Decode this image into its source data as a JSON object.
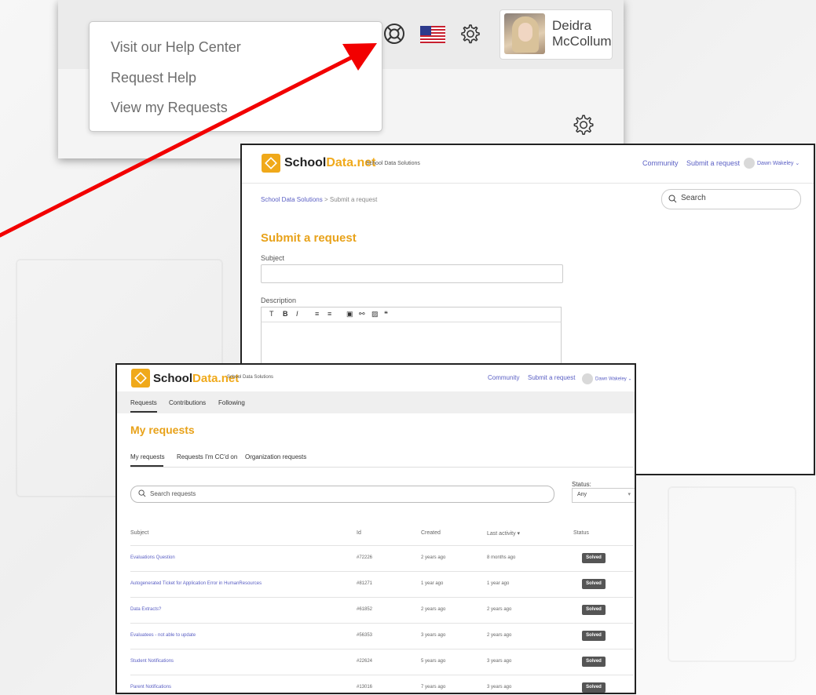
{
  "colors": {
    "accent": "#f0a91a",
    "link": "#5a5fc4",
    "arrow": "#f20000",
    "badge": "#555555"
  },
  "help_header": {
    "menu": {
      "items": [
        "Visit our Help Center",
        "Request Help",
        "View my Requests"
      ]
    },
    "icons": [
      "help-lifebuoy-icon",
      "us-flag-icon",
      "gear-icon"
    ],
    "user": {
      "first_name": "Deidra",
      "last_name": "McCollum"
    }
  },
  "submit_page": {
    "brand": {
      "school": "School",
      "data": "Data.net",
      "sub": "School Data Solutions"
    },
    "nav": {
      "community": "Community",
      "submit": "Submit a request",
      "user": "Dawn Wakeley ⌄"
    },
    "breadcrumb": {
      "root": "School Data Solutions",
      "sep": ">",
      "current": "Submit a request"
    },
    "search_placeholder": "Search",
    "title": "Submit a request",
    "subject_label": "Subject",
    "description_label": "Description",
    "toolbar": [
      "T",
      "B",
      "I",
      "≡",
      "≡",
      "▣",
      "⚯",
      "▨",
      "❝"
    ]
  },
  "requests_page": {
    "brand": {
      "school": "School",
      "data": "Data.net",
      "sub": "School Data Solutions"
    },
    "nav": {
      "community": "Community",
      "submit": "Submit a request",
      "user": "Dawn Wakeley ⌄"
    },
    "subnav": [
      "Requests",
      "Contributions",
      "Following"
    ],
    "title": "My requests",
    "tabs": [
      "My requests",
      "Requests I'm CC'd on",
      "Organization requests"
    ],
    "search_placeholder": "Search requests",
    "status_label": "Status:",
    "status_value": "Any",
    "columns": [
      "Subject",
      "Id",
      "Created",
      "Last activity ▾",
      "Status"
    ],
    "rows": [
      {
        "subject": "Evaluations Question",
        "id": "#72226",
        "created": "2 years ago",
        "last": "8 months ago",
        "status": "Solved"
      },
      {
        "subject": "Autogenerated Ticket for Application Error in HumanResources",
        "id": "#81271",
        "created": "1 year ago",
        "last": "1 year ago",
        "status": "Solved"
      },
      {
        "subject": "Data Extracts?",
        "id": "#61852",
        "created": "2 years ago",
        "last": "2 years ago",
        "status": "Solved"
      },
      {
        "subject": "Evaluatees - not able to update",
        "id": "#56353",
        "created": "3 years ago",
        "last": "2 years ago",
        "status": "Solved"
      },
      {
        "subject": "Student Notifications",
        "id": "#22624",
        "created": "5 years ago",
        "last": "3 years ago",
        "status": "Solved"
      },
      {
        "subject": "Parent Notifications",
        "id": "#13016",
        "created": "7 years ago",
        "last": "3 years ago",
        "status": "Solved"
      }
    ]
  }
}
